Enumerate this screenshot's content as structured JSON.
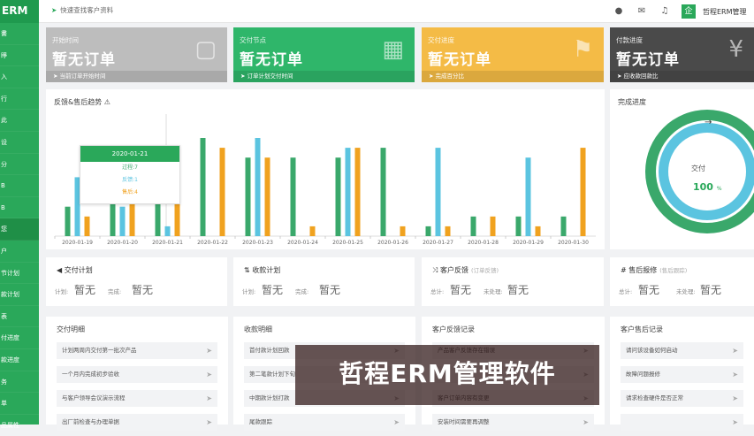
{
  "sidebar": {
    "logo": "ERM",
    "items": [
      "畵",
      "睜",
      "入",
      "行",
      "此",
      "设",
      "分",
      "B",
      "B",
      "您",
      "户",
      "节计划",
      "款计划",
      "表",
      "付进度",
      "款进度",
      "务",
      "单",
      "品属性"
    ],
    "active_index": 9
  },
  "topbar": {
    "search_placeholder": "快速查找客户资料",
    "avatar_text": "企",
    "user_name": "哲程ERM管理"
  },
  "cards": [
    {
      "label": "开始时间",
      "value": "暂无订单",
      "footer": "当前订单开始时间",
      "color": "#bdbdbd",
      "icon": "calendar-icon"
    },
    {
      "label": "交付节点",
      "value": "暂无订单",
      "footer": "订单计划交付时间",
      "color": "#2fb66a",
      "icon": "grid-calendar-icon"
    },
    {
      "label": "交付进度",
      "value": "暂无订单",
      "footer": "完成百分比",
      "color": "#f4bb46",
      "icon": "flag-icon"
    },
    {
      "label": "付款进度",
      "value": "暂无订单",
      "footer": "应收款回款比",
      "color": "#4a4a4a",
      "icon": "money-icon"
    }
  ],
  "trend": {
    "title": "反馈&售后趋势",
    "tooltip": {
      "date": "2020-01-21",
      "rows": [
        "过程:7",
        "反馈:1",
        "售后:4"
      ]
    }
  },
  "chart_data": {
    "type": "bar",
    "categories": [
      "2020-01-19",
      "2020-01-20",
      "2020-01-21",
      "2020-01-22",
      "2020-01-23",
      "2020-01-24",
      "2020-01-25",
      "2020-01-26",
      "2020-01-27",
      "2020-01-28",
      "2020-01-29",
      "2020-01-30"
    ],
    "series": [
      {
        "name": "过程",
        "color": "#3aa86b",
        "values": [
          3,
          5,
          7,
          10,
          8,
          8,
          8,
          9,
          1,
          2,
          2,
          2
        ]
      },
      {
        "name": "反馈",
        "color": "#5bc4e0",
        "values": [
          6,
          3,
          1,
          0,
          10,
          0,
          9,
          0,
          9,
          0,
          8,
          0
        ]
      },
      {
        "name": "售后",
        "color": "#f0a21f",
        "values": [
          2,
          4,
          4,
          9,
          8,
          1,
          9,
          1,
          1,
          2,
          1,
          9
        ]
      }
    ],
    "ylim": [
      0,
      10
    ]
  },
  "progress": {
    "title": "完成进度",
    "label": "交付",
    "value": "100",
    "unit": "%",
    "fraction": 1.0
  },
  "stats": [
    {
      "icon": "send-icon",
      "title": "交付计划",
      "sub": "",
      "l1": "计划:",
      "v1": "暂无",
      "l2": "完成:",
      "v2": "暂无"
    },
    {
      "icon": "sync-icon",
      "title": "收款计划",
      "sub": "",
      "l1": "计划:",
      "v1": "暂无",
      "l2": "完成:",
      "v2": "暂无"
    },
    {
      "icon": "shuffle-icon",
      "title": "客户反馈",
      "sub": "(订单反馈)",
      "l1": "总计:",
      "v1": "暂无",
      "l2": "未处理:",
      "v2": "暂无"
    },
    {
      "icon": "hash-icon",
      "title": "售后报修",
      "sub": "(售后跟踪)",
      "l1": "总计:",
      "v1": "暂无",
      "l2": "未处理:",
      "v2": "暂无"
    }
  ],
  "lists": [
    {
      "title": "交付明细",
      "rows": [
        "计划两周内交付第一批次产品",
        "一个月内完成初步验收",
        "与客户领导会议演示流程",
        "出厂前检查与办理单据"
      ]
    },
    {
      "title": "收款明细",
      "rows": [
        "首付款计划回款",
        "第二笔款计划下旬",
        "中期款计划打款",
        "尾款跟踪"
      ]
    },
    {
      "title": "客户反馈记录",
      "rows": [
        "产品客户反馈存在错误",
        "",
        "客户订单内容有变更",
        "安装时间需要再调整"
      ]
    },
    {
      "title": "客户售后记录",
      "rows": [
        "请问该设备如何启动",
        "故障问题报修",
        "请求检查硬件是否正常",
        ""
      ]
    }
  ],
  "overlay": "哲程ERM管理软件"
}
